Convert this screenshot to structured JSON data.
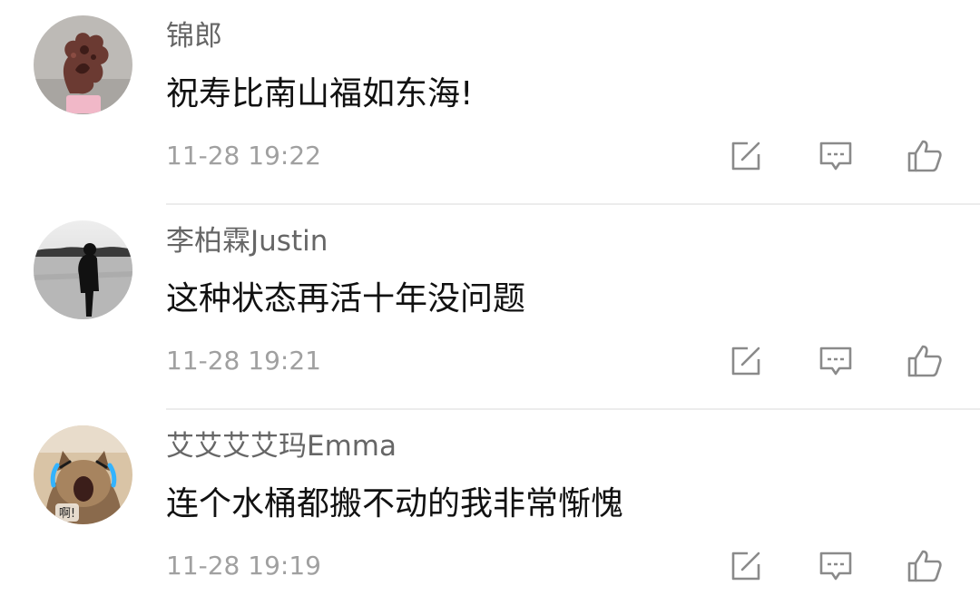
{
  "comments": [
    {
      "username": "锦郎",
      "text": "祝寿比南山福如东海!",
      "time": "11-28 19:22",
      "avatar": "rock-sculpture-avatar"
    },
    {
      "username": "李柏霖Justin",
      "text": "这种状态再活十年没问题",
      "time": "11-28 19:21",
      "avatar": "silhouette-man-avatar"
    },
    {
      "username": "艾艾艾艾玛Emma",
      "text": "连个水桶都搬不动的我非常惭愧",
      "time": "11-28 19:19",
      "avatar": "crying-cat-avatar",
      "avatar_text": "啊!"
    }
  ],
  "icons": {
    "share": "share-icon",
    "reply": "comment-icon",
    "like": "thumbs-up-icon"
  },
  "colors": {
    "username": "#666666",
    "text": "#111111",
    "time": "#a0a0a0",
    "icon": "#8a8a8a",
    "divider": "#ececec"
  }
}
